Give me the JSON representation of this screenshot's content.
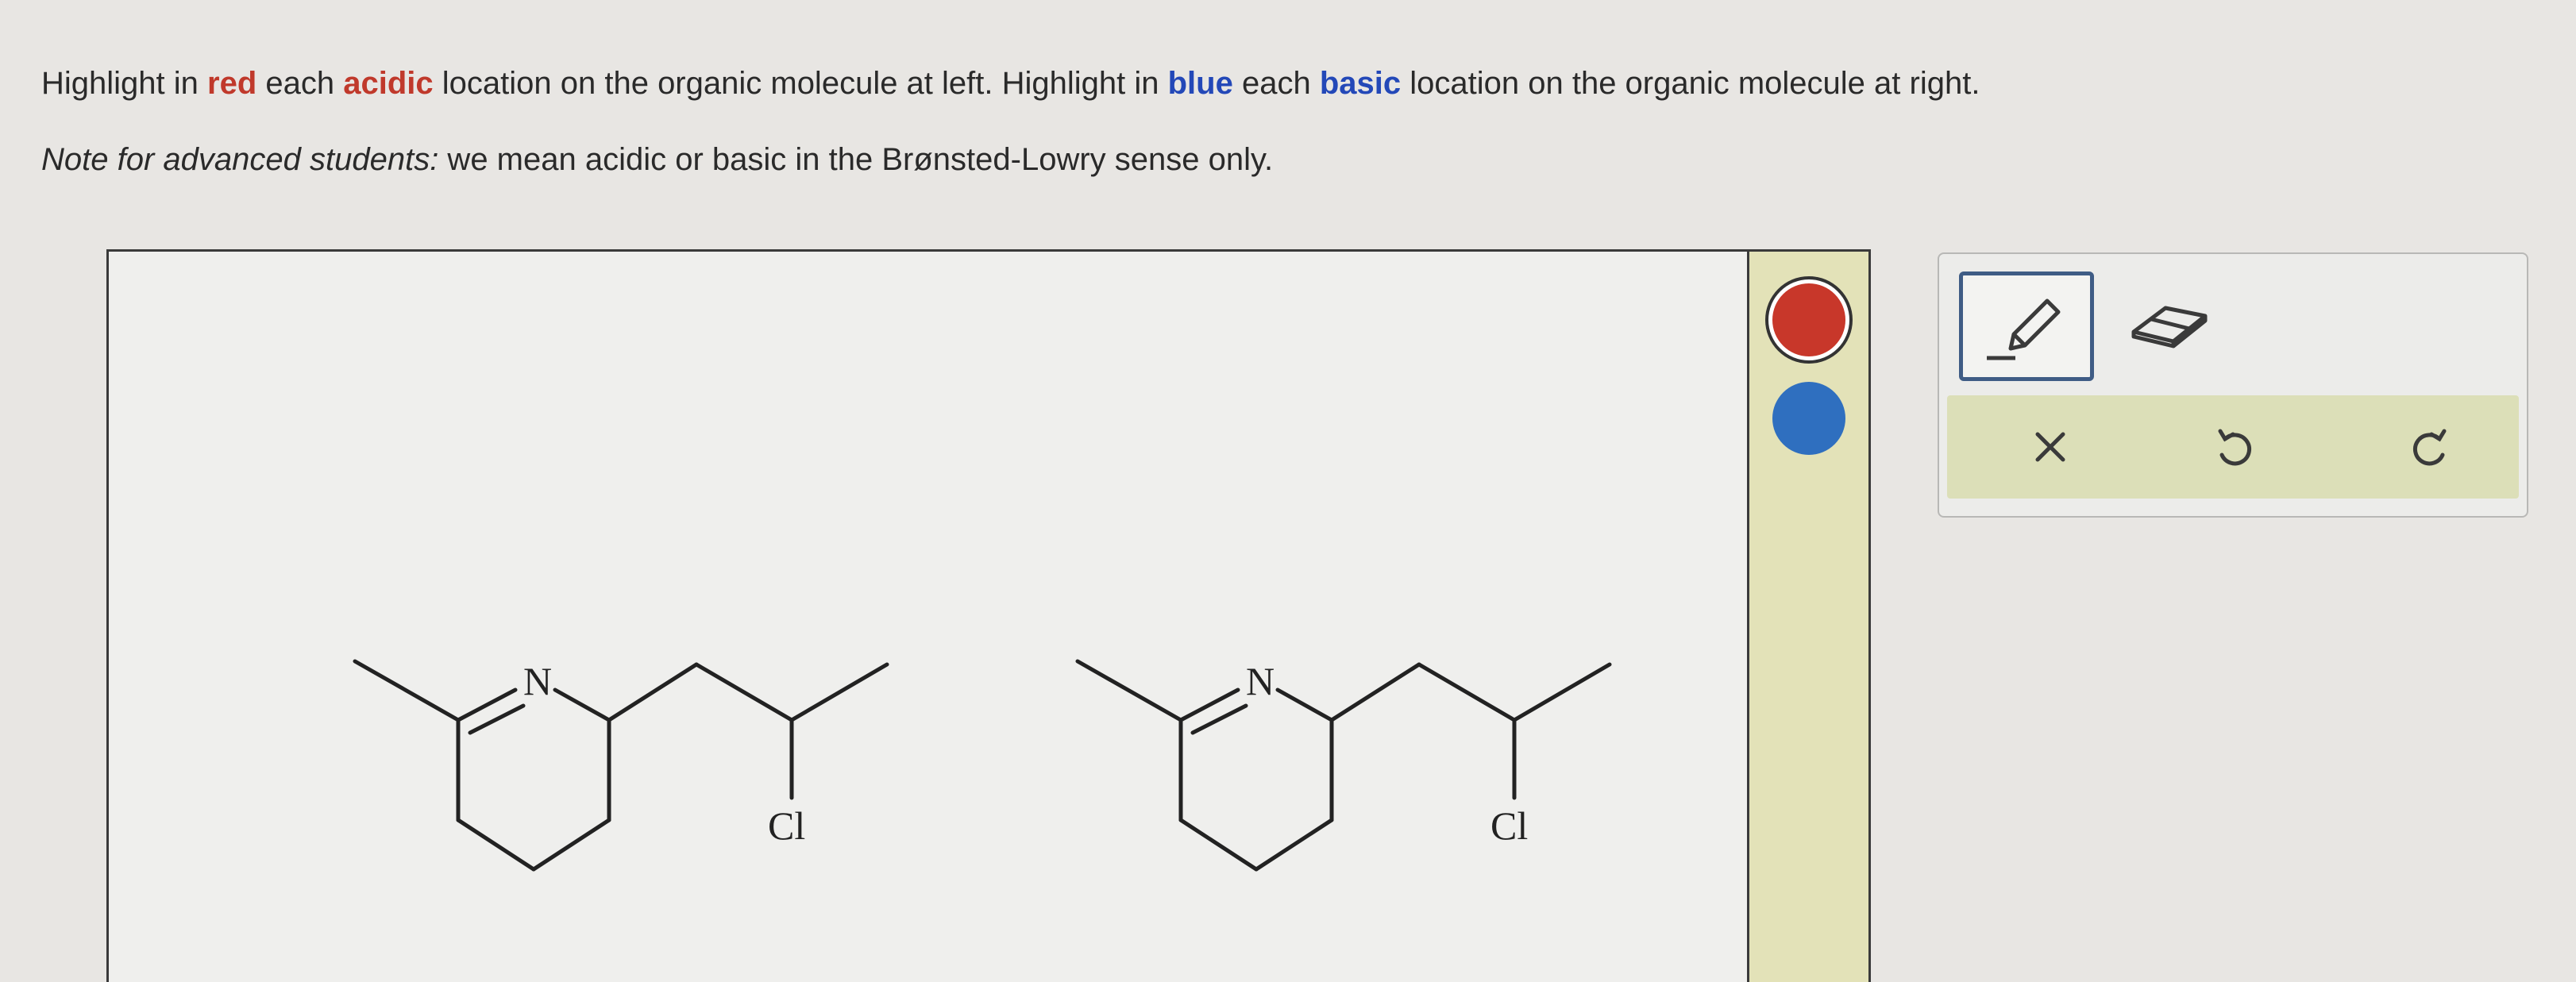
{
  "instructions": {
    "line1": {
      "t1": "Highlight in ",
      "red": "red",
      "t2": " each ",
      "acidic": "acidic",
      "t3": " location on the organic molecule at left. Highlight in ",
      "blue": "blue",
      "t4": " each ",
      "basic": "basic",
      "t5": " location on the organic molecule at right."
    },
    "line2": {
      "italic": "Note for advanced students:",
      "rest": " we mean acidic or basic in the Brønsted-Lowry sense only."
    }
  },
  "molecules": {
    "left": {
      "nitrogen_label": "N",
      "chlorine_label": "Cl"
    },
    "right": {
      "nitrogen_label": "N",
      "chlorine_label": "Cl"
    }
  },
  "palette": {
    "red_color": "#c8372a",
    "blue_color": "#2f6fbf",
    "selected": "red"
  },
  "toolbox": {
    "tools": [
      "pencil-icon",
      "eraser-icon"
    ],
    "selected_tool": "pencil",
    "actions": [
      "clear-icon",
      "undo-icon",
      "redo-icon"
    ]
  }
}
